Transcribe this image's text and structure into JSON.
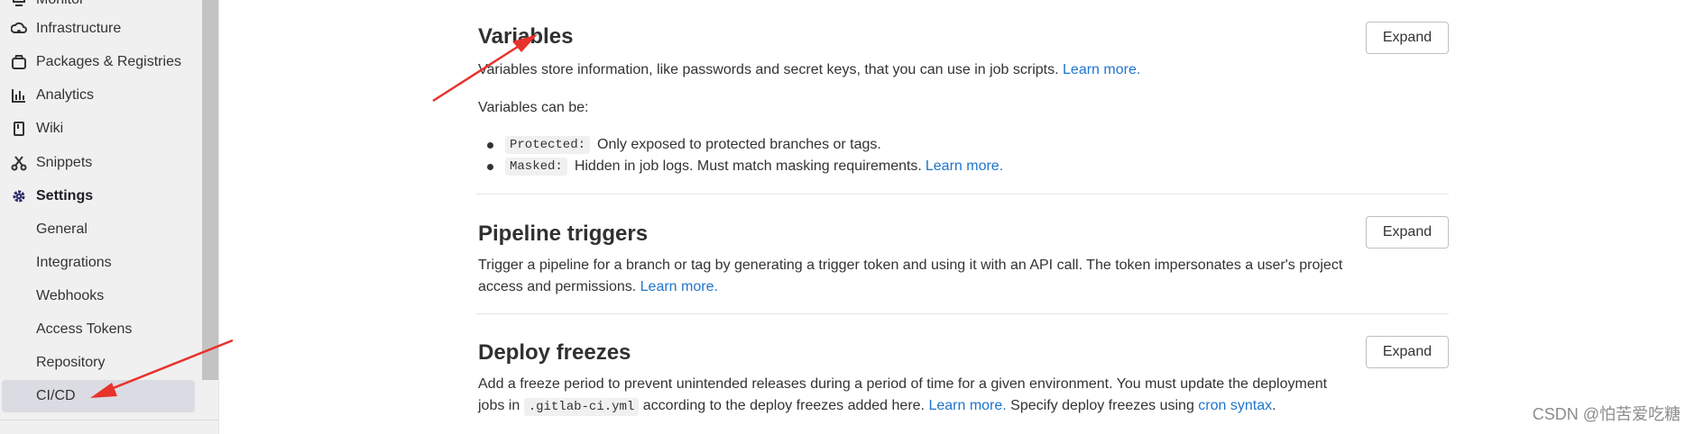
{
  "sidebar": {
    "items": [
      {
        "label": "Monitor",
        "icon": "monitor-icon"
      },
      {
        "label": "Infrastructure",
        "icon": "cloud-gear-icon"
      },
      {
        "label": "Packages & Registries",
        "icon": "package-icon"
      },
      {
        "label": "Analytics",
        "icon": "chart-icon"
      },
      {
        "label": "Wiki",
        "icon": "book-icon"
      },
      {
        "label": "Snippets",
        "icon": "scissors-icon"
      },
      {
        "label": "Settings",
        "icon": "gear-icon"
      }
    ],
    "settings_sub": [
      {
        "label": "General"
      },
      {
        "label": "Integrations"
      },
      {
        "label": "Webhooks"
      },
      {
        "label": "Access Tokens"
      },
      {
        "label": "Repository"
      },
      {
        "label": "CI/CD"
      }
    ]
  },
  "sections": {
    "variables": {
      "title": "Variables",
      "desc": "Variables store information, like passwords and secret keys, that you can use in job scripts.",
      "learn_more": "Learn more.",
      "can_be": "Variables can be:",
      "bullets": [
        {
          "code": "Protected:",
          "text": "Only exposed to protected branches or tags.",
          "link": ""
        },
        {
          "code": "Masked:",
          "text": "Hidden in job logs. Must match masking requirements.",
          "link": "Learn more."
        }
      ],
      "button": "Expand"
    },
    "pipeline_triggers": {
      "title": "Pipeline triggers",
      "desc_line1": "Trigger a pipeline for a branch or tag by generating a trigger token and using it with an API call. The token impersonates a user's project",
      "desc_line2": "access and permissions.",
      "learn_more": "Learn more.",
      "button": "Expand"
    },
    "deploy_freezes": {
      "title": "Deploy freezes",
      "desc_line1": "Add a freeze period to prevent unintended releases during a period of time for a given environment. You must update the deployment",
      "desc_line2_pre": "jobs in",
      "code": ".gitlab-ci.yml",
      "desc_line2_mid": "according to the deploy freezes added here.",
      "learn_more": "Learn more.",
      "desc_line2_post": "Specify deploy freezes using",
      "cron_link": "cron syntax",
      "period": ".",
      "button": "Expand"
    }
  },
  "watermark": "CSDN @怕苦爱吃糖",
  "colors": {
    "arrow": "#e8322c",
    "link": "#1f75cb"
  }
}
